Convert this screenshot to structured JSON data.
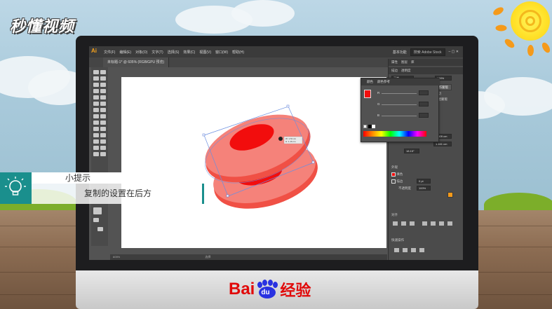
{
  "watermark": "秒懂视频",
  "brand": {
    "bai": "Bai",
    "du": "du",
    "jingyan": "经验"
  },
  "app": {
    "logo": "Ai",
    "menu": [
      "文件(F)",
      "编辑(E)",
      "对象(O)",
      "文字(T)",
      "选择(S)",
      "效果(C)",
      "视图(V)",
      "窗口(W)",
      "帮助(H)"
    ],
    "workspace": "基本功能",
    "search_placeholder": "搜索 Adobe Stock",
    "doc_tab": "未标题-1* @ 605% (RGB/GPU 预览)",
    "status_zoom": "605%",
    "status_mode": "选择"
  },
  "right_panel": {
    "tabs": [
      "属性",
      "图层",
      "库"
    ],
    "tabs2": [
      "描边",
      "透明度"
    ],
    "blend_mode": "正常",
    "opacity": "100%",
    "make_mask_button": "制作蒙版",
    "clip": "剪切",
    "invert_mask": "反相蒙版",
    "width": "1.509 cm",
    "height": "1.161 cm",
    "rotation": "18.15°",
    "appearance_title": "外观",
    "fill_label": "填色",
    "stroke_label": "描边",
    "stroke_value": "0 pt",
    "opacity_label": "不透明度",
    "opacity_value": "100%",
    "align_title": "对齐",
    "quick_actions_title": "快速操作"
  },
  "color_panel": {
    "tabs": [
      "颜色",
      "颜色参考"
    ],
    "labels": [
      "R",
      "G",
      "B"
    ]
  },
  "canvas_tooltip": {
    "line1": "W: 1.51 cm",
    "line2": "H: 1.16 cm"
  },
  "tip": {
    "title": "小提示",
    "body": "复制的设置在后方"
  },
  "colors": {
    "shape_fill": "#f5827a",
    "shape_inner": "#f20d0d",
    "shape_side": "#f05045",
    "tip_teal": "#1a8f8d",
    "baidu_red": "#e10a0a",
    "baidu_blue": "#2932e1"
  }
}
